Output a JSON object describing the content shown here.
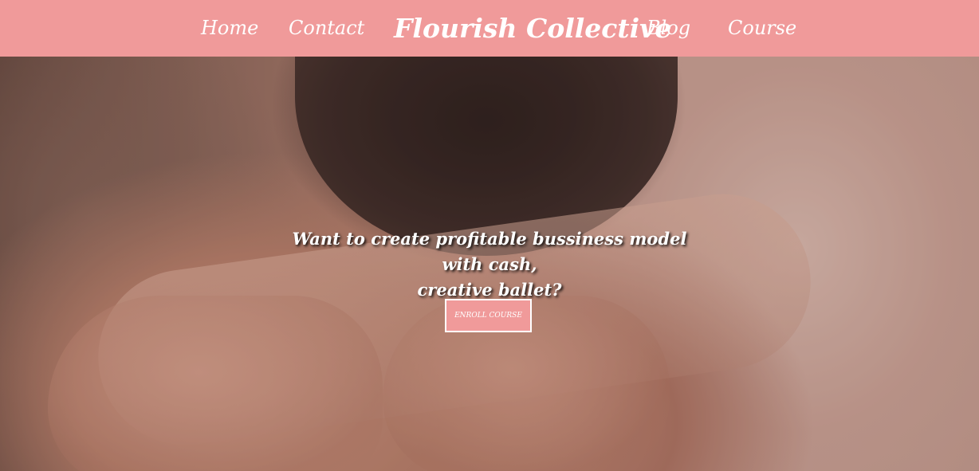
{
  "header": {
    "nav_left": [
      {
        "label": "Home"
      },
      {
        "label": "Contact"
      }
    ],
    "brand": "Flourish Collective",
    "nav_right": [
      {
        "label": "Blog"
      },
      {
        "label": "Course"
      }
    ]
  },
  "hero": {
    "headline_line1": "Want to create profitable bussiness model with cash,",
    "headline_line2": "creative ballet?",
    "cta_label": "ENROLL COURSE"
  },
  "colors": {
    "header_bg": "#f09a9a",
    "text": "#ffffff",
    "button_bg": "#f09a9a"
  }
}
